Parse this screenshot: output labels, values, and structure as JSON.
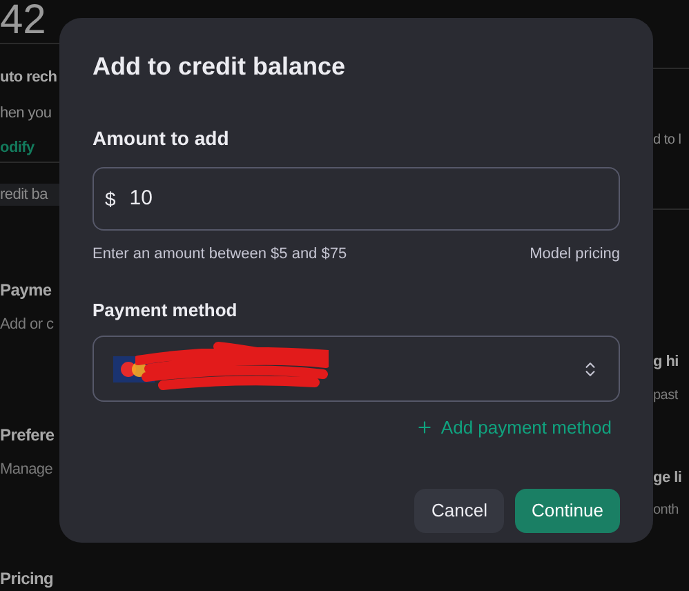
{
  "page_behind": {
    "amount": "42",
    "auto_recharge": {
      "title": "uto rech",
      "text": "hen you",
      "link": "odify"
    },
    "credit_button": "redit ba",
    "sections": [
      {
        "title": "Payme",
        "text": "Add or c"
      },
      {
        "title": "Prefere",
        "text": "Manage"
      },
      {
        "title": "Pricing"
      }
    ],
    "right_column": {
      "auto_text": "d to l",
      "sections": [
        {
          "title": "g hi",
          "text": "past"
        },
        {
          "title": "ge li",
          "text": "onth"
        }
      ]
    }
  },
  "dialog": {
    "title": "Add to credit balance",
    "amount": {
      "label": "Amount to add",
      "currency": "$",
      "value": "10",
      "hint": "Enter an amount between $5 and $75",
      "link": "Model pricing"
    },
    "payment": {
      "label": "Payment method",
      "add_link": "Add payment method"
    },
    "buttons": [
      {
        "label": "Cancel",
        "kind": "secondary"
      },
      {
        "label": "Continue",
        "kind": "primary"
      }
    ]
  }
}
